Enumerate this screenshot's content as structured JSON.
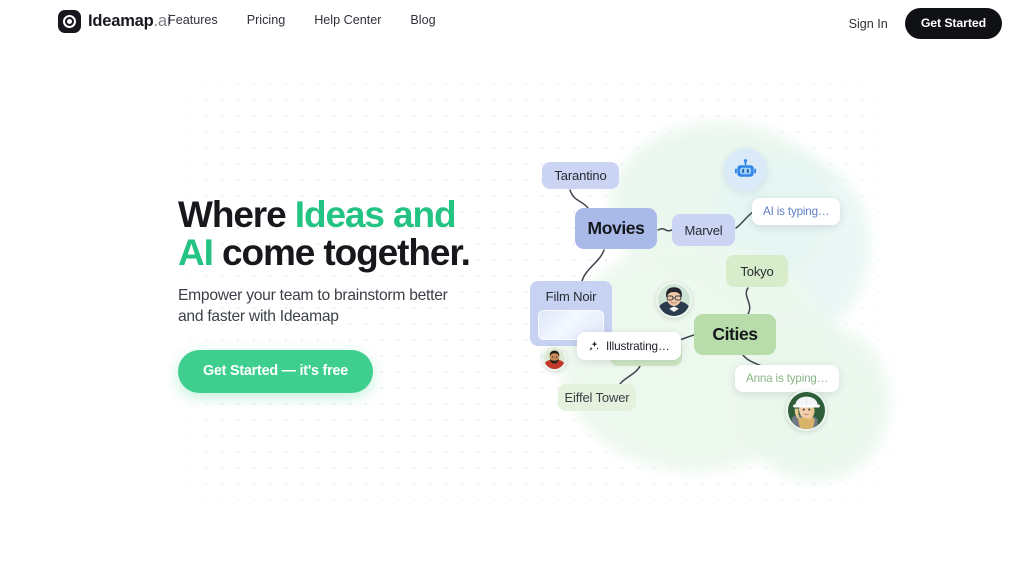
{
  "header": {
    "brand": {
      "name": "Ideamap",
      "tld": ".ai",
      "logo_icon": "aperture-target-icon"
    },
    "nav": [
      {
        "label": "Features"
      },
      {
        "label": "Pricing"
      },
      {
        "label": "Help Center"
      },
      {
        "label": "Blog"
      }
    ],
    "sign_in_label": "Sign In",
    "get_started_label": "Get Started"
  },
  "hero": {
    "title_line1_pre": "Where ",
    "title_line1_accent": "Ideas and",
    "title_line2_accent": "AI",
    "title_line2_post": " come together.",
    "subtitle": "Empower your team to brainstorm better and faster with Ideamap",
    "cta_label": "Get Started — it's free"
  },
  "mindmap": {
    "nodes": [
      {
        "id": "movies",
        "label": "Movies",
        "kind": "main",
        "color": "#a9bae9"
      },
      {
        "id": "tarantino",
        "label": "Tarantino",
        "kind": "sub",
        "color": "#ccd4f3"
      },
      {
        "id": "marvel",
        "label": "Marvel",
        "kind": "sub",
        "color": "#ccd4f3"
      },
      {
        "id": "filmnoir",
        "label": "Film Noir",
        "kind": "sub",
        "color": "#c7d2f2"
      },
      {
        "id": "cities",
        "label": "Cities",
        "kind": "main",
        "color": "#b8ddab"
      },
      {
        "id": "tokyo",
        "label": "Tokyo",
        "kind": "sub",
        "color": "#d6ecca"
      },
      {
        "id": "paris",
        "label": "",
        "kind": "sub",
        "color": "#cfe8c5"
      },
      {
        "id": "eiffel",
        "label": "Eiffel Tower",
        "kind": "sub",
        "color": "#e4f1dd"
      }
    ],
    "status_chips": [
      {
        "id": "ai",
        "label": "AI is typing…",
        "color": "#5f7fc4"
      },
      {
        "id": "anna",
        "label": "Anna is typing…",
        "color": "#8ab584"
      },
      {
        "id": "illus",
        "label": "Illustrating…",
        "color": "#20242b",
        "icon": "sparkles-icon"
      }
    ],
    "ai_agent": {
      "icon": "robot-icon",
      "bubble_color": "#dbeaf9"
    },
    "collaborators": [
      {
        "id": "anna",
        "icon": "avatar-woman-glasses"
      },
      {
        "id": "ravi",
        "icon": "avatar-man-beard"
      },
      {
        "id": "lena",
        "icon": "avatar-woman-hardhat"
      }
    ]
  },
  "colors": {
    "brand_green": "#3ecf8e",
    "accent_green": "#23c483",
    "dark": "#101114",
    "node_blue": "#a9bae9",
    "node_green": "#b8ddab"
  }
}
